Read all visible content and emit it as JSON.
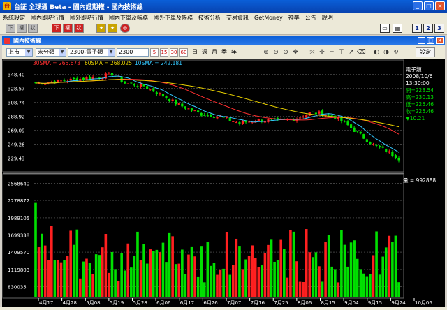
{
  "title": "台証 全球通 Beta - 國內證期權 - 國內技術線",
  "menu": [
    "系統設定",
    "國內即時行情",
    "國外即時行情",
    "國內下單及帳務",
    "國外下單及帳務",
    "技術分析",
    "交易資訊",
    "GetMoney",
    "神準",
    "公告",
    "說明"
  ],
  "toolbar_left": [
    "下",
    "權",
    "狀",
    "下",
    "權",
    "狀"
  ],
  "toolbar_right": [
    "1",
    "2",
    "3"
  ],
  "child_title": "國內技術線",
  "market": "上市",
  "period": "未分類",
  "stock": "2300-電子類",
  "code": "2300",
  "periods": [
    "5",
    "15",
    "30",
    "60",
    "日",
    "週",
    "月",
    "季",
    "年"
  ],
  "settings_label": "設定",
  "sma": [
    {
      "label": "30SMA = 265.673",
      "color": "#ff3030"
    },
    {
      "label": "60SMA = 268.025",
      "color": "#e8d000"
    },
    {
      "label": "10SMA = 242.181",
      "color": "#34c8ff"
    }
  ],
  "info": {
    "name": "電子類",
    "date": "2008/10/6",
    "time": "13:30:00",
    "open": "開=228.54",
    "high": "高=230.13",
    "low": "低=225.46",
    "close": "收=225.46",
    "change": "▼10.21"
  },
  "volume_label": "量 = 992888",
  "colors": {
    "up": "#ff2020",
    "down": "#00e000",
    "grid": "#404040",
    "axis": "#ffffff"
  },
  "chart_data": {
    "type": "candlestick",
    "price_ticks": [
      "348.40",
      "328.57",
      "308.74",
      "288.92",
      "269.09",
      "249.26",
      "229.43"
    ],
    "volume_ticks": [
      "2568640",
      "2278872",
      "1989105",
      "1699338",
      "1409570",
      "1119803",
      "830035"
    ],
    "x_labels": [
      "4月17",
      "4月28",
      "5月08",
      "5月19",
      "5月28",
      "6月06",
      "6月17",
      "6月26",
      "7月07",
      "7月16",
      "7月25",
      "8月06",
      "8月15",
      "9月04",
      "9月15",
      "9月24",
      "10月06"
    ],
    "price_range": [
      225,
      352
    ],
    "volume_range": [
      660000,
      2680000
    ]
  }
}
